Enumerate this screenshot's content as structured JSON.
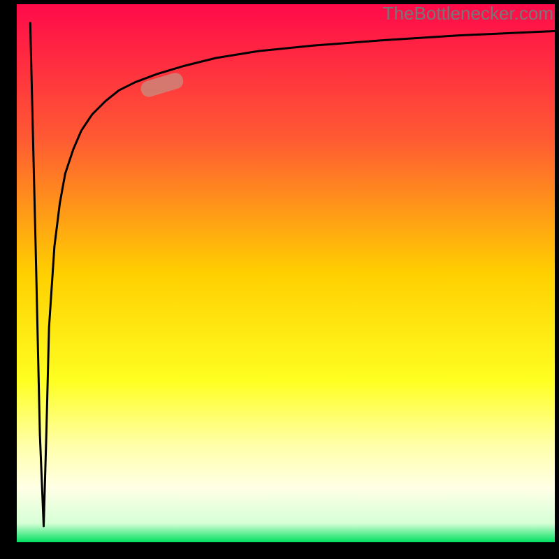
{
  "watermark": "TheBottlenecker.com",
  "chart_data": {
    "type": "line",
    "title": "",
    "xlabel": "",
    "ylabel": "",
    "xlim": [
      0,
      100
    ],
    "ylim": [
      0,
      100
    ],
    "annotations": [
      {
        "name": "highlight-pill",
        "x": 27,
        "y": 85
      }
    ],
    "background": {
      "type": "vertical-gradient",
      "stops": [
        {
          "offset": 0.0,
          "color": "#ff0a4a"
        },
        {
          "offset": 0.25,
          "color": "#ff5a33"
        },
        {
          "offset": 0.5,
          "color": "#ffcf00"
        },
        {
          "offset": 0.7,
          "color": "#ffff22"
        },
        {
          "offset": 0.82,
          "color": "#ffffaa"
        },
        {
          "offset": 0.9,
          "color": "#ffffe6"
        },
        {
          "offset": 0.965,
          "color": "#d6ffd6"
        },
        {
          "offset": 1.0,
          "color": "#00e060"
        }
      ]
    },
    "series": [
      {
        "name": "spike-and-log",
        "comment": "x normalized 0..100, y normalized 0..100; sharp spike near x≈5 down to ~2 then log-like rise toward ~95",
        "x": [
          2.5,
          3.5,
          4.3,
          5.0,
          5.5,
          6.0,
          7.0,
          8.0,
          9.0,
          10.5,
          12.0,
          14.0,
          16.5,
          19.0,
          22.0,
          26.0,
          31.0,
          37.0,
          45.0,
          55.0,
          68.0,
          82.0,
          100.0
        ],
        "y": [
          96.5,
          55.0,
          20.0,
          3.0,
          20.0,
          40.0,
          55.0,
          63.0,
          68.5,
          73.0,
          76.5,
          79.5,
          82.0,
          84.0,
          85.5,
          87.0,
          88.5,
          90.0,
          91.3,
          92.3,
          93.3,
          94.2,
          95.0
        ]
      }
    ]
  }
}
